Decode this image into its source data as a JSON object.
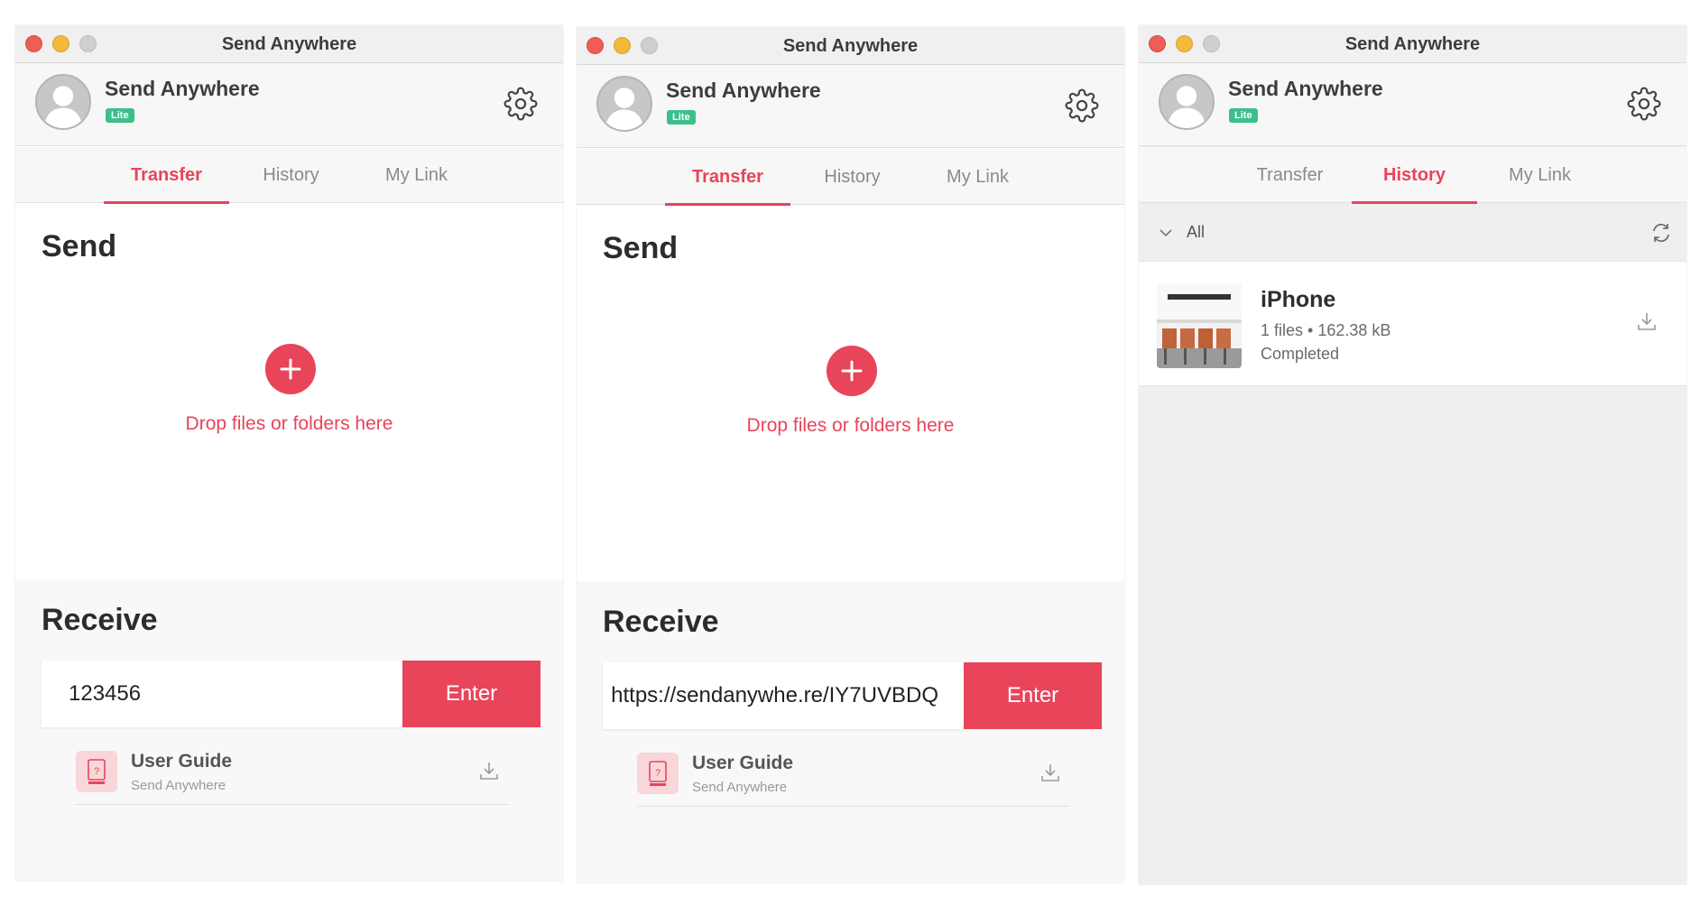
{
  "colors": {
    "accent": "#e8445a",
    "badge": "#3cbf8a",
    "close": "#ee5d56",
    "minimize": "#f2b93a",
    "maximize": "#cfcfcf"
  },
  "icons": [
    "close-dot",
    "minimize-dot",
    "maximize-dot",
    "avatar",
    "gear-icon",
    "plus-icon",
    "help-icon",
    "download-icon",
    "chevron-down-icon",
    "refresh-icon"
  ],
  "windows": [
    {
      "title": "Send Anywhere",
      "app_name": "Send Anywhere",
      "badge": "Lite",
      "tabs": [
        {
          "label": "Transfer",
          "active": true
        },
        {
          "label": "History",
          "active": false
        },
        {
          "label": "My Link",
          "active": false
        }
      ],
      "send": {
        "heading": "Send",
        "drop_text": "Drop files or folders here"
      },
      "receive": {
        "heading": "Receive",
        "input_value": "123456",
        "enter_label": "Enter",
        "guide": {
          "title": "User Guide",
          "subtitle": "Send Anywhere"
        }
      }
    },
    {
      "title": "Send Anywhere",
      "app_name": "Send Anywhere",
      "badge": "Lite",
      "tabs": [
        {
          "label": "Transfer",
          "active": true
        },
        {
          "label": "History",
          "active": false
        },
        {
          "label": "My Link",
          "active": false
        }
      ],
      "send": {
        "heading": "Send",
        "drop_text": "Drop files or folders here"
      },
      "receive": {
        "heading": "Receive",
        "input_value": "https://sendanywhe.re/IY7UVBDQ",
        "enter_label": "Enter",
        "guide": {
          "title": "User Guide",
          "subtitle": "Send Anywhere"
        }
      }
    },
    {
      "title": "Send Anywhere",
      "app_name": "Send Anywhere",
      "badge": "Lite",
      "tabs": [
        {
          "label": "Transfer",
          "active": false
        },
        {
          "label": "History",
          "active": true
        },
        {
          "label": "My Link",
          "active": false
        }
      ],
      "filter": {
        "label": "All"
      },
      "history": [
        {
          "title": "iPhone",
          "meta": "1 files • 162.38 kB",
          "status": "Completed"
        }
      ]
    }
  ]
}
